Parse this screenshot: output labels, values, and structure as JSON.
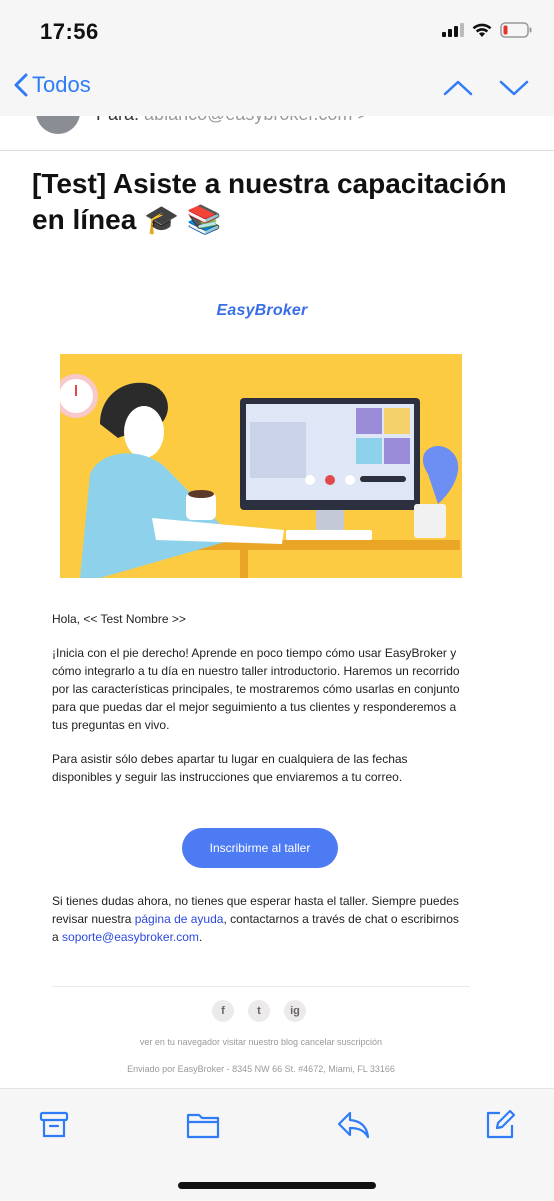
{
  "status": {
    "time": "17:56"
  },
  "nav": {
    "back_label": "Todos"
  },
  "header": {
    "to_label": "Para:",
    "to_address": "ablanco@easybroker.com",
    "to_chevron": ">"
  },
  "subject": "[Test] Asiste a nuestra capacitación en línea 🎓 📚",
  "email": {
    "logo": "EasyBroker",
    "greeting": "Hola, << Test Nombre >>",
    "para1": "¡Inicia con el pie derecho! Aprende en poco tiempo cómo usar EasyBroker y cómo integrarlo a tu día en nuestro taller introductorio. Haremos un recorrido por las características principales, te mostraremos cómo usarlas en conjunto para que puedas dar el mejor seguimiento a tus clientes y responderemos a tus preguntas en vivo.",
    "para2": "Para asistir sólo debes apartar tu lugar en cualquiera de las fechas disponibles y seguir las instrucciones que enviaremos a tu correo.",
    "cta_label": "Inscribirme al taller",
    "para3_a": "Si tienes dudas ahora, no tienes que esperar hasta el taller. Siempre puedes revisar nuestra ",
    "para3_link1": "página de ayuda",
    "para3_b": ", contactarnos a través de chat o escribirnos a ",
    "para3_link2": "soporte@easybroker.com",
    "para3_c": ".",
    "social": [
      "f",
      "t",
      "ig"
    ],
    "footer_links": "ver en tu navegador visitar nuestro blog cancelar suscripción",
    "footer_address": "Enviado por EasyBroker - 8345 NW 66 St. #4672, Miami, FL 33166"
  },
  "toolbar": {
    "icons": [
      "archive-icon",
      "folder-icon",
      "reply-icon",
      "compose-icon"
    ]
  },
  "colors": {
    "accent": "#2f7cf6",
    "cta": "#4d7bf4",
    "hero_bg": "#fcd04a"
  }
}
